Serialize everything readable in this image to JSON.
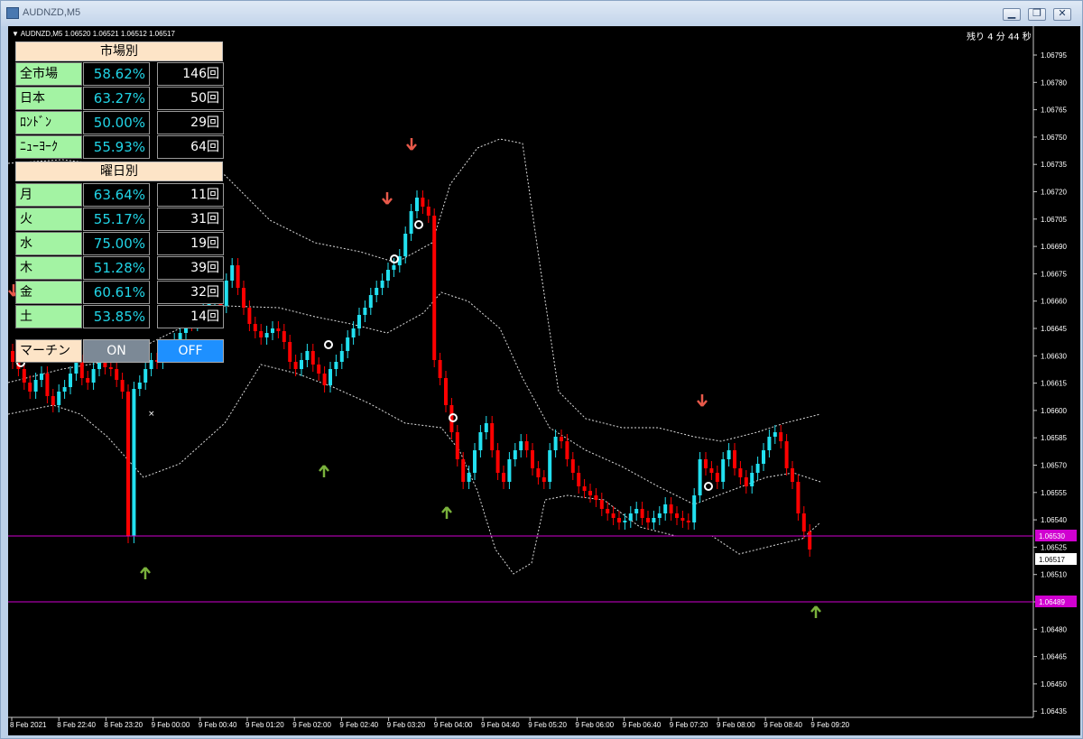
{
  "window": {
    "title": "AUDNZD,M5",
    "minimize": "▁",
    "restore": "❐",
    "close": "✕"
  },
  "chart": {
    "header": "▼ AUDNZD,M5  1.06520 1.06521 1.06512 1.06517",
    "timer": "残り 4 分 44 秒",
    "current_price": "1.06517",
    "line_top_price": "1.06530",
    "line_bottom_price": "1.06489",
    "colors": {
      "bull": "#22e0f0",
      "bear": "#ff0000",
      "line": "#d000d0",
      "up_arrow": "#7ab23c",
      "down_arrow": "#e8594a"
    },
    "price_axis": [
      "1.06795",
      "1.06780",
      "1.06765",
      "1.06750",
      "1.06735",
      "1.06720",
      "1.06705",
      "1.06690",
      "1.06675",
      "1.06660",
      "1.06645",
      "1.06630",
      "1.06615",
      "1.06600",
      "1.06585",
      "1.06570",
      "1.06555",
      "1.06540",
      "1.06525",
      "1.06510",
      "1.06495",
      "1.06480",
      "1.06465",
      "1.06450",
      "1.06435"
    ],
    "time_axis": [
      "8 Feb 2021",
      "8 Feb 22:40",
      "8 Feb 23:20",
      "9 Feb 00:00",
      "9 Feb 00:40",
      "9 Feb 01:20",
      "9 Feb 02:00",
      "9 Feb 02:40",
      "9 Feb 03:20",
      "9 Feb 04:00",
      "9 Feb 04:40",
      "9 Feb 05:20",
      "9 Feb 06:00",
      "9 Feb 06:40",
      "9 Feb 07:20",
      "9 Feb 08:00",
      "9 Feb 08:40",
      "9 Feb 09:20"
    ]
  },
  "panel": {
    "market_header": "市場別",
    "market_rows": [
      {
        "label": "全市場",
        "pct": "58.62%",
        "count": "146回"
      },
      {
        "label": "日本",
        "pct": "63.27%",
        "count": "50回"
      },
      {
        "label": "ﾛﾝﾄﾞﾝ",
        "pct": "50.00%",
        "count": "29回"
      },
      {
        "label": "ﾆｭｰﾖｰｸ",
        "pct": "55.93%",
        "count": "64回"
      }
    ],
    "weekday_header": "曜日別",
    "weekday_rows": [
      {
        "label": "月",
        "pct": "63.64%",
        "count": "11回"
      },
      {
        "label": "火",
        "pct": "55.17%",
        "count": "31回"
      },
      {
        "label": "水",
        "pct": "75.00%",
        "count": "19回"
      },
      {
        "label": "木",
        "pct": "51.28%",
        "count": "39回"
      },
      {
        "label": "金",
        "pct": "60.61%",
        "count": "32回"
      },
      {
        "label": "土",
        "pct": "53.85%",
        "count": "14回"
      }
    ],
    "martin_label": "マーチン",
    "on_label": "ON",
    "off_label": "OFF"
  }
}
